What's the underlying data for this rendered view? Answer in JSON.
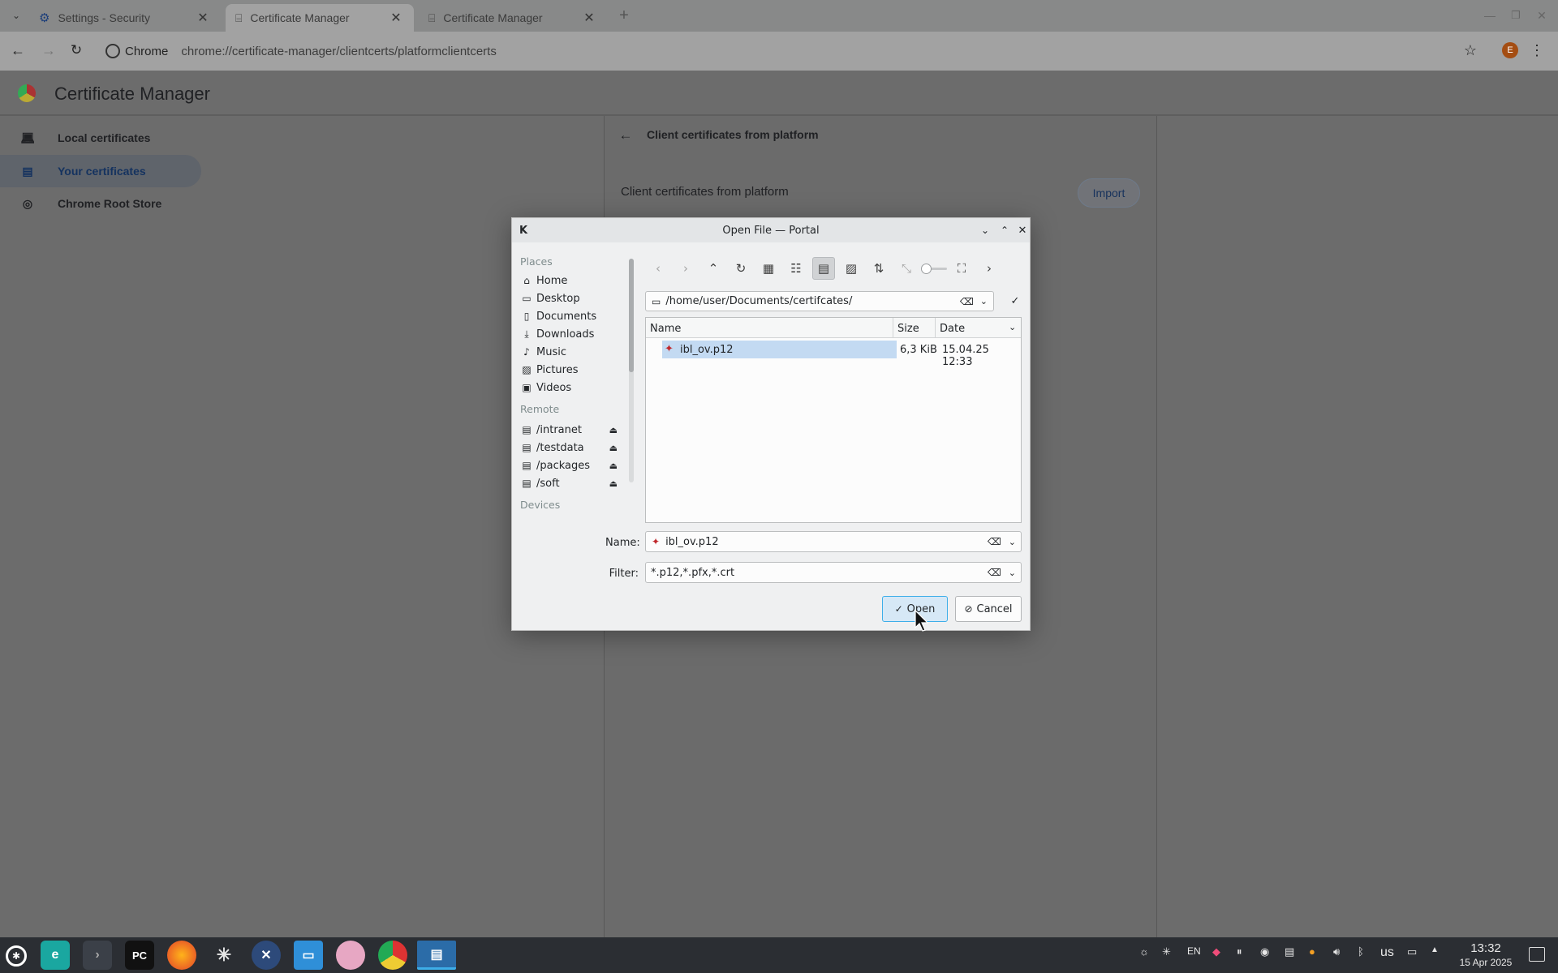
{
  "browser": {
    "tabs": [
      {
        "title": "Settings - Security"
      },
      {
        "title": "Certificate Manager"
      },
      {
        "title": "Certificate Manager"
      }
    ],
    "omnibox": {
      "chip": "Chrome",
      "url": "chrome://certificate-manager/clientcerts/platformclientcerts"
    },
    "profile_initial": "E"
  },
  "page": {
    "title": "Certificate Manager",
    "nav": [
      {
        "label": "Local certificates"
      },
      {
        "label": "Your certificates"
      },
      {
        "label": "Chrome Root Store"
      }
    ],
    "subpage_title": "Client certificates from platform",
    "section_label": "Client certificates from platform",
    "import_label": "Import"
  },
  "dialog": {
    "title": "Open File — Portal",
    "places_heading": "Places",
    "places": [
      {
        "label": "Home",
        "icon": "home-icon"
      },
      {
        "label": "Desktop",
        "icon": "desktop-icon"
      },
      {
        "label": "Documents",
        "icon": "documents-icon"
      },
      {
        "label": "Downloads",
        "icon": "downloads-icon"
      },
      {
        "label": "Music",
        "icon": "music-icon"
      },
      {
        "label": "Pictures",
        "icon": "pictures-icon"
      },
      {
        "label": "Videos",
        "icon": "videos-icon"
      }
    ],
    "remote_heading": "Remote",
    "remote": [
      {
        "label": "/intranet"
      },
      {
        "label": "/testdata"
      },
      {
        "label": "/packages"
      },
      {
        "label": "/soft"
      }
    ],
    "devices_heading": "Devices",
    "path": "/home/user/Documents/certifcates/",
    "columns": {
      "name": "Name",
      "size": "Size",
      "date": "Date"
    },
    "files": [
      {
        "name": "ibl_ov.p12",
        "size": "6,3 KiB",
        "date": "15.04.25 12:33",
        "selected": true
      }
    ],
    "name_label": "Name:",
    "name_value": "ibl_ov.p12",
    "filter_label": "Filter:",
    "filter_value": "*.p12,*.pfx,*.crt",
    "open_label": "Open",
    "cancel_label": "Cancel"
  },
  "taskbar": {
    "keyboard_layout": "us",
    "lang": "EN",
    "time": "13:32",
    "date": "15 Apr 2025"
  },
  "colors": {
    "accent": "#3daee9",
    "selection": "#c3daf2",
    "cert_icon": "#c0282c"
  }
}
